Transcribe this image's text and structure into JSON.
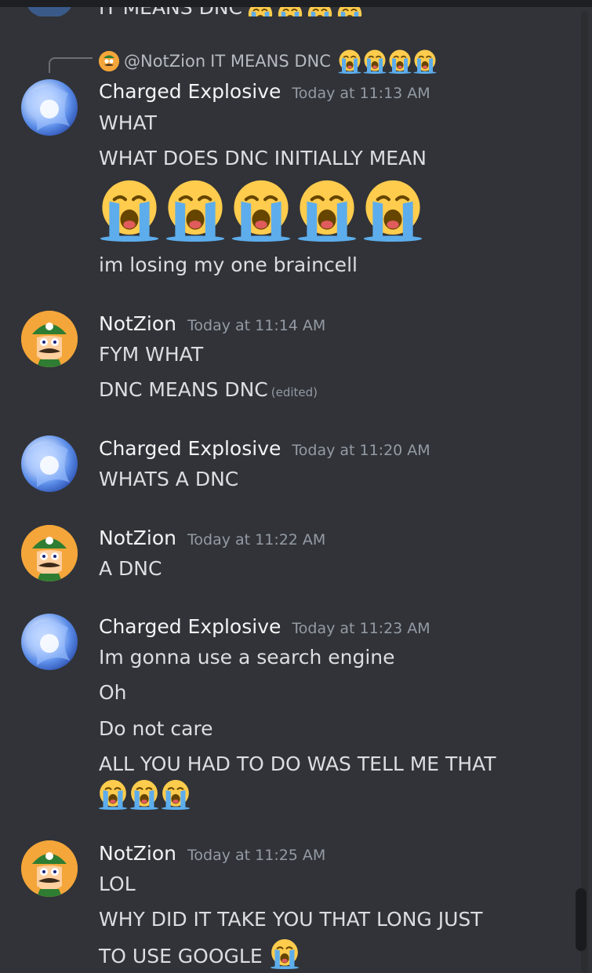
{
  "previous_message": {
    "text": "IT MEANS DNC"
  },
  "reply": {
    "mention": "@NotZion",
    "text": "IT MEANS DNC"
  },
  "messages": [
    {
      "author": "Charged Explosive",
      "time": "Today at 11:13 AM",
      "lines": [
        "WHAT",
        "WHAT DOES DNC INITIALLY MEAN",
        "im losing my one braincell"
      ]
    },
    {
      "author": "NotZion",
      "time": "Today at 11:14 AM",
      "lines": [
        "FYM WHAT",
        "DNC MEANS DNC"
      ],
      "edited": "(edited)"
    },
    {
      "author": "Charged Explosive",
      "time": "Today at 11:20 AM",
      "lines": [
        "WHATS A DNC"
      ]
    },
    {
      "author": "NotZion",
      "time": "Today at 11:22 AM",
      "lines": [
        "A DNC"
      ]
    },
    {
      "author": "Charged Explosive",
      "time": "Today at 11:23 AM",
      "lines": [
        "Im gonna use a search engine",
        "Oh",
        "Do not care",
        "ALL YOU HAD TO DO WAS TELL ME THAT"
      ]
    },
    {
      "author": "NotZion",
      "time": "Today at 11:25 AM",
      "lines": [
        "LOL",
        "WHY DID IT TAKE YOU THAT LONG JUST",
        "TO USE GOOGLE"
      ]
    }
  ],
  "icons": [
    "loudly-crying-emoji",
    "user-avatar"
  ],
  "colors": {
    "background": "#313338",
    "text": "#dbdee1",
    "muted": "#949ba4",
    "username": "#f2f3f5"
  }
}
